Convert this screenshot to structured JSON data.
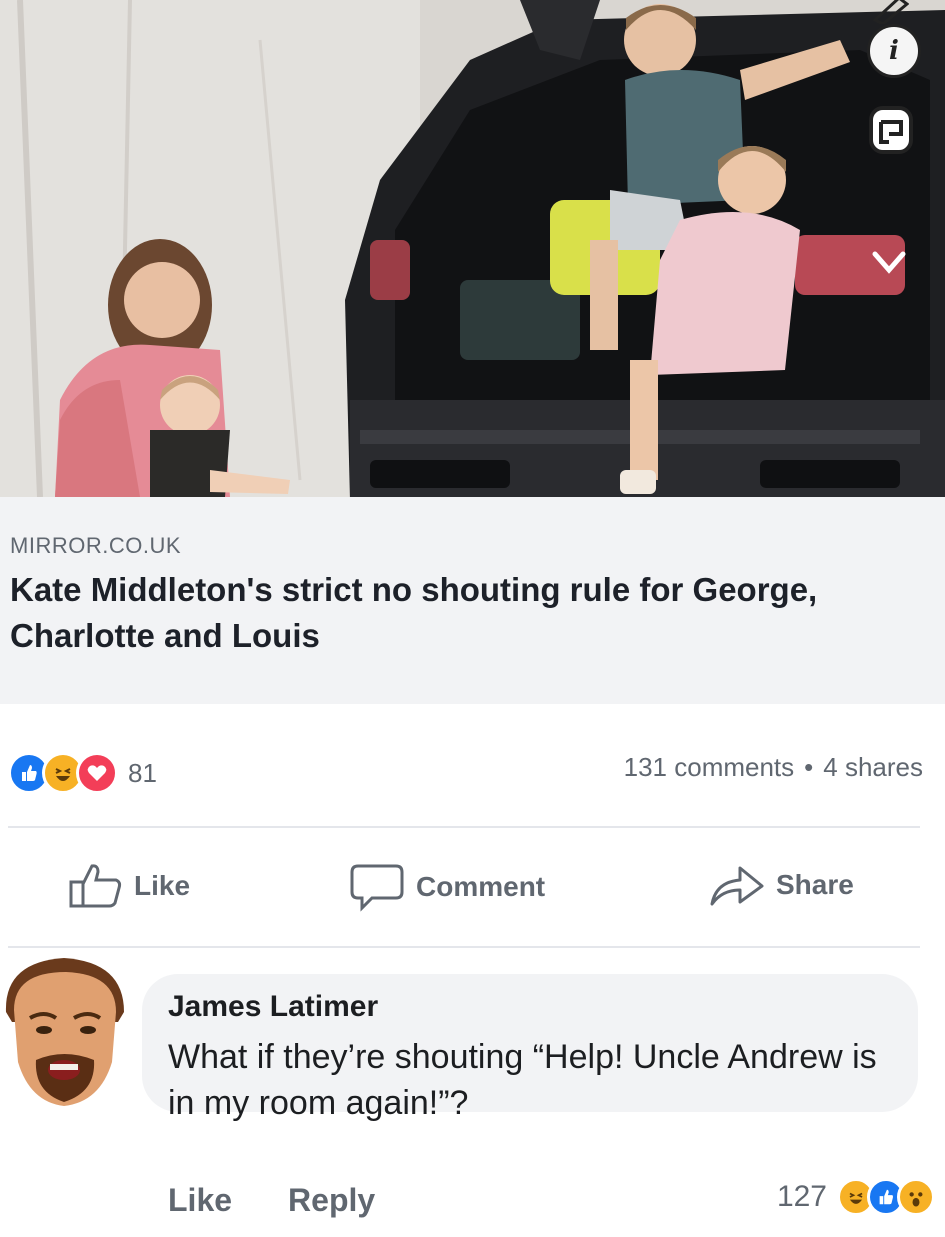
{
  "link_preview": {
    "domain": "MIRROR.CO.UK",
    "title": "Kate Middleton's strict no shouting rule for George, Charlotte and Louis"
  },
  "reactions": {
    "icons": [
      "like-reaction",
      "haha-reaction",
      "love-reaction"
    ],
    "count": "81"
  },
  "stats": {
    "comments": "131 comments",
    "separator": "•",
    "shares": "4 shares"
  },
  "actions": {
    "like": "Like",
    "comment": "Comment",
    "share": "Share"
  },
  "comment": {
    "author": "James Latimer",
    "text": "What if they’re shouting “Help! Uncle Andrew is in my room again!”?",
    "like": "Like",
    "reply": "Reply",
    "reaction_count": "127",
    "reaction_icons": [
      "haha-reaction",
      "like-reaction",
      "wow-reaction"
    ]
  },
  "photo_controls": {
    "info_glyph": "i"
  },
  "colors": {
    "like_blue": "#1877f2",
    "love_red": "#f33e58",
    "haha_yellow": "#f7b125",
    "meta_gray": "#606770",
    "bubble_bg": "#f2f3f5"
  }
}
